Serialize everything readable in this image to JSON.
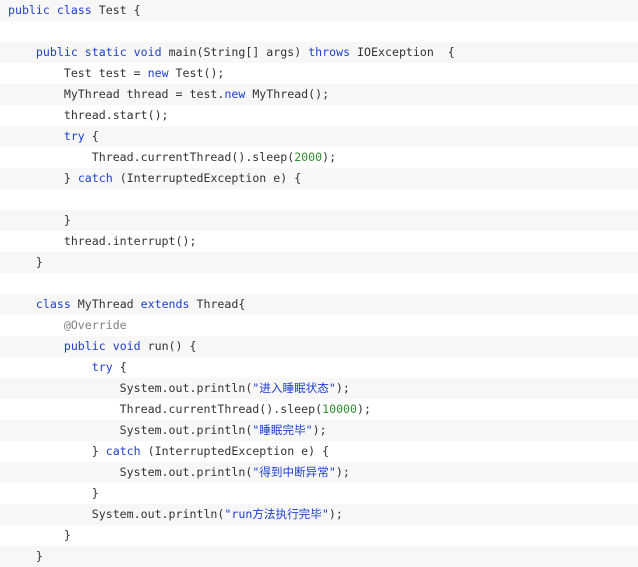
{
  "code": {
    "lines": [
      [
        {
          "t": "public",
          "k": "kw"
        },
        {
          "t": " "
        },
        {
          "t": "class",
          "k": "kw"
        },
        {
          "t": " Test {"
        }
      ],
      [],
      [
        {
          "t": "    "
        },
        {
          "t": "public",
          "k": "kw"
        },
        {
          "t": " "
        },
        {
          "t": "static",
          "k": "kw"
        },
        {
          "t": " "
        },
        {
          "t": "void",
          "k": "kw"
        },
        {
          "t": " main(String[] args) "
        },
        {
          "t": "throws",
          "k": "kw"
        },
        {
          "t": " IOException  {"
        }
      ],
      [
        {
          "t": "        Test test = "
        },
        {
          "t": "new",
          "k": "kw"
        },
        {
          "t": " Test();"
        }
      ],
      [
        {
          "t": "        MyThread thread = test."
        },
        {
          "t": "new",
          "k": "kw"
        },
        {
          "t": " MyThread();"
        }
      ],
      [
        {
          "t": "        thread.start();"
        }
      ],
      [
        {
          "t": "        "
        },
        {
          "t": "try",
          "k": "kw"
        },
        {
          "t": " {"
        }
      ],
      [
        {
          "t": "            Thread.currentThread().sleep("
        },
        {
          "t": "2000",
          "k": "num"
        },
        {
          "t": ");"
        }
      ],
      [
        {
          "t": "        } "
        },
        {
          "t": "catch",
          "k": "kw"
        },
        {
          "t": " (InterruptedException e) {"
        }
      ],
      [],
      [
        {
          "t": "        }"
        }
      ],
      [
        {
          "t": "        thread.interrupt();"
        }
      ],
      [
        {
          "t": "    }"
        }
      ],
      [],
      [
        {
          "t": "    "
        },
        {
          "t": "class",
          "k": "kw"
        },
        {
          "t": " MyThread "
        },
        {
          "t": "extends",
          "k": "kw"
        },
        {
          "t": " Thread{"
        }
      ],
      [
        {
          "t": "        "
        },
        {
          "t": "@Override",
          "k": "ann"
        }
      ],
      [
        {
          "t": "        "
        },
        {
          "t": "public",
          "k": "kw"
        },
        {
          "t": " "
        },
        {
          "t": "void",
          "k": "kw"
        },
        {
          "t": " run() {"
        }
      ],
      [
        {
          "t": "            "
        },
        {
          "t": "try",
          "k": "kw"
        },
        {
          "t": " {"
        }
      ],
      [
        {
          "t": "                System.out.println("
        },
        {
          "t": "\"进入睡眠状态\"",
          "k": "str"
        },
        {
          "t": ");"
        }
      ],
      [
        {
          "t": "                Thread.currentThread().sleep("
        },
        {
          "t": "10000",
          "k": "num"
        },
        {
          "t": ");"
        }
      ],
      [
        {
          "t": "                System.out.println("
        },
        {
          "t": "\"睡眠完毕\"",
          "k": "str"
        },
        {
          "t": ");"
        }
      ],
      [
        {
          "t": "            } "
        },
        {
          "t": "catch",
          "k": "kw"
        },
        {
          "t": " (InterruptedException e) {"
        }
      ],
      [
        {
          "t": "                System.out.println("
        },
        {
          "t": "\"得到中断异常\"",
          "k": "str"
        },
        {
          "t": ");"
        }
      ],
      [
        {
          "t": "            }"
        }
      ],
      [
        {
          "t": "            System.out.println("
        },
        {
          "t": "\"run方法执行完毕\"",
          "k": "str"
        },
        {
          "t": ");"
        }
      ],
      [
        {
          "t": "        }"
        }
      ],
      [
        {
          "t": "    }"
        }
      ]
    ]
  },
  "colors": {
    "keyword": "#1f3fd1",
    "number": "#2e8b2e",
    "string": "#1f3fd1",
    "annotation": "#808080",
    "text": "#333333",
    "row_alt": "#f7f7f7"
  }
}
